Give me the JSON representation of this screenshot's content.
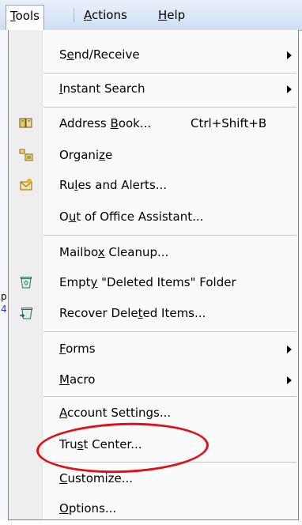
{
  "menubar": {
    "tools": {
      "pre": "",
      "ul": "T",
      "post": "ools"
    },
    "actions": {
      "pre": "",
      "ul": "A",
      "post": "ctions"
    },
    "help": {
      "pre": "",
      "ul": "H",
      "post": "elp"
    }
  },
  "behind_fragments": [
    "p",
    "4"
  ],
  "menu": {
    "send_receive": {
      "pre": "S",
      "ul": "e",
      "post": "nd/Receive"
    },
    "instant_search": {
      "pre": "",
      "ul": "I",
      "post": "nstant Search"
    },
    "address_book": {
      "pre": "Address ",
      "ul": "B",
      "post": "ook...",
      "shortcut": "Ctrl+Shift+B"
    },
    "organize": {
      "pre": "Organi",
      "ul": "z",
      "post": "e"
    },
    "rules_alerts": {
      "pre": "Ru",
      "ul": "l",
      "post": "es and Alerts..."
    },
    "out_of_office": {
      "pre": "O",
      "ul": "u",
      "post": "t of Office Assistant..."
    },
    "mailbox_cleanup": {
      "pre": "Mailbo",
      "ul": "x",
      "post": " Cleanup..."
    },
    "empty_deleted": {
      "pre": "Empt",
      "ul": "y",
      "post": " \"Deleted Items\" Folder"
    },
    "recover_deleted": {
      "pre": "Recover Dele",
      "ul": "t",
      "post": "ed Items..."
    },
    "forms": {
      "pre": "",
      "ul": "F",
      "post": "orms"
    },
    "macro": {
      "pre": "",
      "ul": "M",
      "post": "acro"
    },
    "account_settings": {
      "pre": "",
      "ul": "A",
      "post": "ccount Settings..."
    },
    "trust_center": {
      "pre": "Tru",
      "ul": "s",
      "post": "t Center..."
    },
    "customize": {
      "pre": "",
      "ul": "C",
      "post": "ustomize..."
    },
    "options": {
      "pre": "",
      "ul": "O",
      "post": "ptions..."
    }
  },
  "icons": {
    "address_book": "address-book-icon",
    "organize": "organize-icon",
    "rules_alerts": "rules-and-alerts-icon",
    "empty_deleted": "recycle-bin-icon",
    "recover_deleted": "recover-items-icon"
  },
  "colors": {
    "menubar_bg": "#cddff3",
    "highlight_circle": "#e0101a"
  }
}
